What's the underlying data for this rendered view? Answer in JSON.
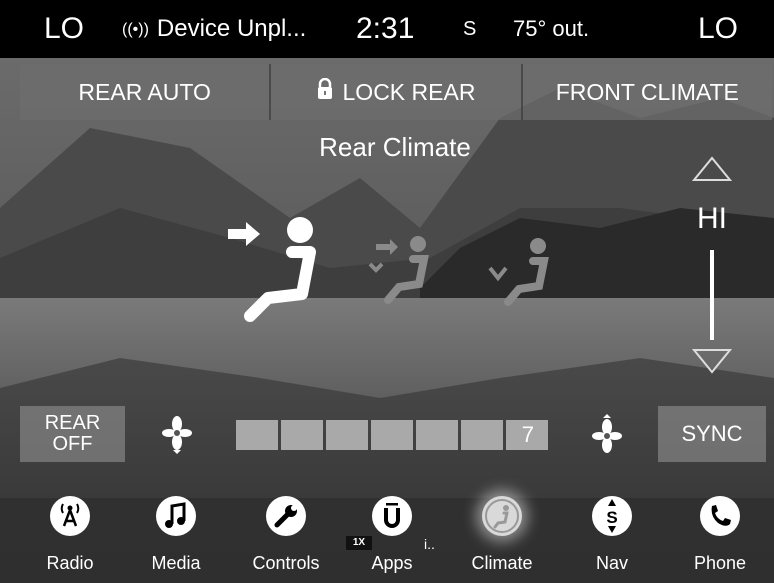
{
  "status": {
    "left_temp": "LO",
    "device": "Device Unpl...",
    "time": "2:31",
    "satellite": "S",
    "outside_temp": "75° out.",
    "right_temp": "LO"
  },
  "top_buttons": {
    "rear_auto": "REAR AUTO",
    "lock_rear": "LOCK REAR",
    "front_climate": "FRONT CLIMATE"
  },
  "title": "Rear Climate",
  "temperature": {
    "setting": "HI",
    "level_fraction": 1.0
  },
  "controls": {
    "rear_off_line1": "REAR",
    "rear_off_line2": "OFF",
    "fan_speed": "7",
    "fan_level": 7,
    "fan_max": 7,
    "sync": "SYNC"
  },
  "nav": {
    "radio": "Radio",
    "media": "Media",
    "controls": "Controls",
    "apps": "Apps",
    "apps_badge": "1X",
    "climate": "Climate",
    "nav": "Nav",
    "nav_letter": "S",
    "phone": "Phone",
    "active": "Climate"
  },
  "icons": {
    "antenna": "antenna-icon",
    "lock": "lock-icon",
    "up": "temp-up-icon",
    "down": "temp-down-icon",
    "fan_low": "fan-low-icon",
    "fan_high": "fan-high-icon"
  }
}
